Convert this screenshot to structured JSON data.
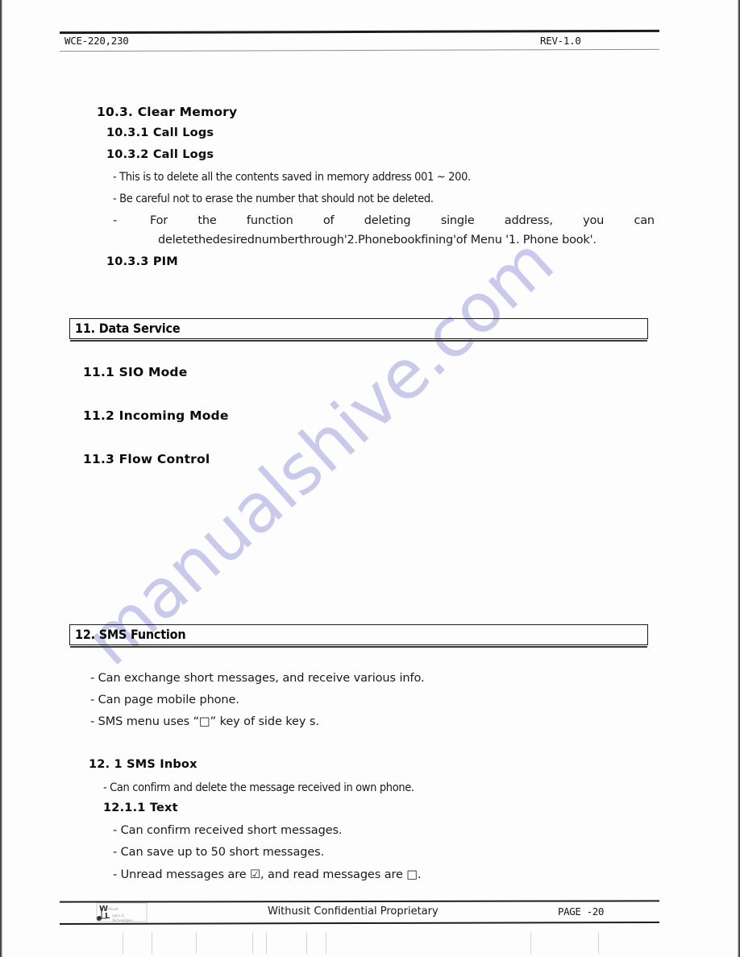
{
  "document": {
    "header": {
      "model": "WCE-220,230",
      "revision": "REV-1.0"
    },
    "footer": {
      "logo_name": "withusit-logo",
      "confidential": "Withusit Confidential Proprietary",
      "page": "PAGE -20"
    },
    "watermark": "manualshive.com",
    "watermark_color": "#c9c9ec"
  },
  "sections": {
    "clear_memory": {
      "heading": "10.3. Clear Memory",
      "sub1": "10.3.1 Call Logs",
      "sub2": "10.3.2 Call Logs",
      "bullets": [
        "- This is to delete all the contents saved in memory address 001 ~ 200.",
        "- Be careful not to erase the number that should not be deleted."
      ],
      "justified_bullet": {
        "dash": "-",
        "line1_words": [
          "For",
          "the",
          "function",
          "of",
          "deleting",
          "single",
          "address,",
          "you",
          "can"
        ],
        "line2": "deletethedesirednumberthrough'2.Phonebookfining'of Menu '1. Phone book'."
      },
      "sub3": "10.3.3 PIM"
    },
    "data_service": {
      "box_heading": "11. Data Service",
      "sub1": "11.1 SIO Mode",
      "sub2": "11.2 Incoming Mode",
      "sub3": "11.3 Flow Control"
    },
    "sms_function": {
      "box_heading": "12. SMS Function",
      "bullets": [
        "- Can exchange short messages, and receive various info.",
        "- Can page mobile phone."
      ],
      "bullet_sidekey": {
        "prefix": "- SMS menu uses  “",
        "glyph": "□",
        "suffix": "” key of side key s."
      },
      "inbox_heading": "12. 1 SMS Inbox",
      "inbox_bullet": "- Can confirm and delete the message received in own phone.",
      "text_heading": "12.1.1 Text",
      "text_bullets": [
        "- Can confirm received short messages.",
        "- Can save up to 50 short messages."
      ],
      "unread_bullet": {
        "prefix": "- Unread messages are ",
        "unread_glyph": "☑",
        "middle": ", and read messages are ",
        "read_glyph": "□",
        "suffix": "."
      }
    }
  }
}
